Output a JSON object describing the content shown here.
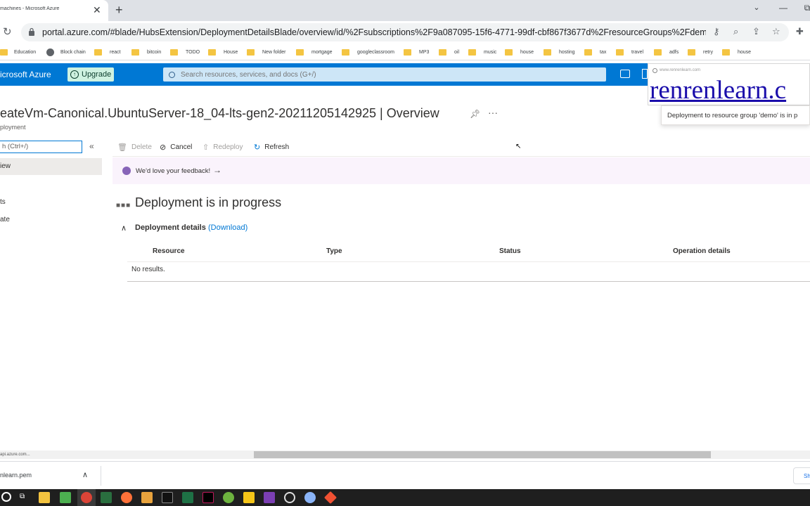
{
  "browser": {
    "tab_title": "machines - Microsoft Azure",
    "tab_close": "✕",
    "new_tab": "+",
    "window_minimize": "—",
    "window_maximize": "⧉",
    "url": "portal.azure.com/#blade/HubsExtension/DeploymentDetailsBlade/overview/id/%2Fsubscriptions%2F9a087095-15f6-4771-99df-cbf867f3677d%2FresourceGroups%2Fdemo%...",
    "bookmarks": [
      "Education",
      "Block chain",
      "react",
      "bitcoin",
      "TODO",
      "House",
      "New folder",
      "mortgage",
      "googleclassroom",
      "MP3",
      "oil",
      "music",
      "house",
      "hosting",
      "tax",
      "travel",
      "adfs",
      "retry",
      "house"
    ]
  },
  "azure": {
    "brand": "icrosoft Azure",
    "upgrade_label": "Upgrade",
    "search_placeholder": "Search resources, services, and docs (G+/)"
  },
  "watermark": {
    "domain": "www.renrenlearn.com",
    "logo": "renrenlearn.c"
  },
  "toast": {
    "text": "Deployment to resource group 'demo' is in p"
  },
  "blade": {
    "title": "eateVm-Canonical.UbuntuServer-18_04-lts-gen2-20211205142925 | Overview",
    "subtitle": "ployment",
    "menu_search": "h (Ctrl+/)",
    "nav_overview": "iew",
    "nav_item_2": "ts",
    "nav_item_3": "ate"
  },
  "commands": {
    "delete": "Delete",
    "cancel": "Cancel",
    "redeploy": "Redeploy",
    "refresh": "Refresh"
  },
  "feedback": {
    "text": "We'd love your feedback!"
  },
  "deployment": {
    "heading": "Deployment is in progress",
    "details_label": "Deployment details",
    "download_link": "(Download)",
    "columns": [
      "Resource",
      "Type",
      "Status",
      "Operation details"
    ],
    "empty_text": "No results."
  },
  "statusbar": {
    "text": "api.azure.com..."
  },
  "downloads": {
    "file_name": "nlearn.pem",
    "show_all": "Sh"
  }
}
